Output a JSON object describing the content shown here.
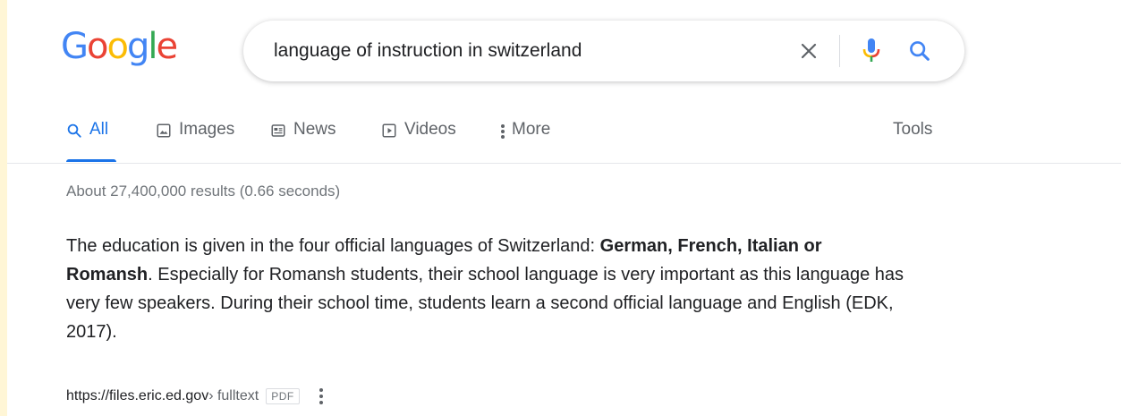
{
  "logo": {
    "letters": [
      "G",
      "o",
      "o",
      "g",
      "l",
      "e"
    ],
    "colors": [
      "#4285f4",
      "#ea4335",
      "#fbbc05",
      "#4285f4",
      "#34a853",
      "#ea4335"
    ]
  },
  "search": {
    "query": "language of instruction in switzerland"
  },
  "tabs": [
    {
      "label": "All",
      "icon": "search-icon",
      "active": true
    },
    {
      "label": "Images",
      "icon": "image-icon",
      "active": false
    },
    {
      "label": "News",
      "icon": "news-icon",
      "active": false
    },
    {
      "label": "Videos",
      "icon": "video-icon",
      "active": false
    },
    {
      "label": "More",
      "icon": "more-vert-icon",
      "active": false
    }
  ],
  "tools_label": "Tools",
  "result_stats": "About 27,400,000 results (0.66 seconds)",
  "snippet": {
    "part1": "The education is given in the four official languages of Switzerland: ",
    "bold": "German, French, Italian or Romansh",
    "part2": ". Especially for Romansh students, their school language is very important as this language has very few speakers. During their school time, students learn a second official language and English (EDK, 2017)."
  },
  "citation": {
    "domain": "https://files.eric.ed.gov",
    "path": " › fulltext",
    "badge": "PDF"
  },
  "colors": {
    "accent": "#1a73e8",
    "text": "#202124",
    "muted": "#5f6368",
    "frame": "#fff6d6"
  }
}
